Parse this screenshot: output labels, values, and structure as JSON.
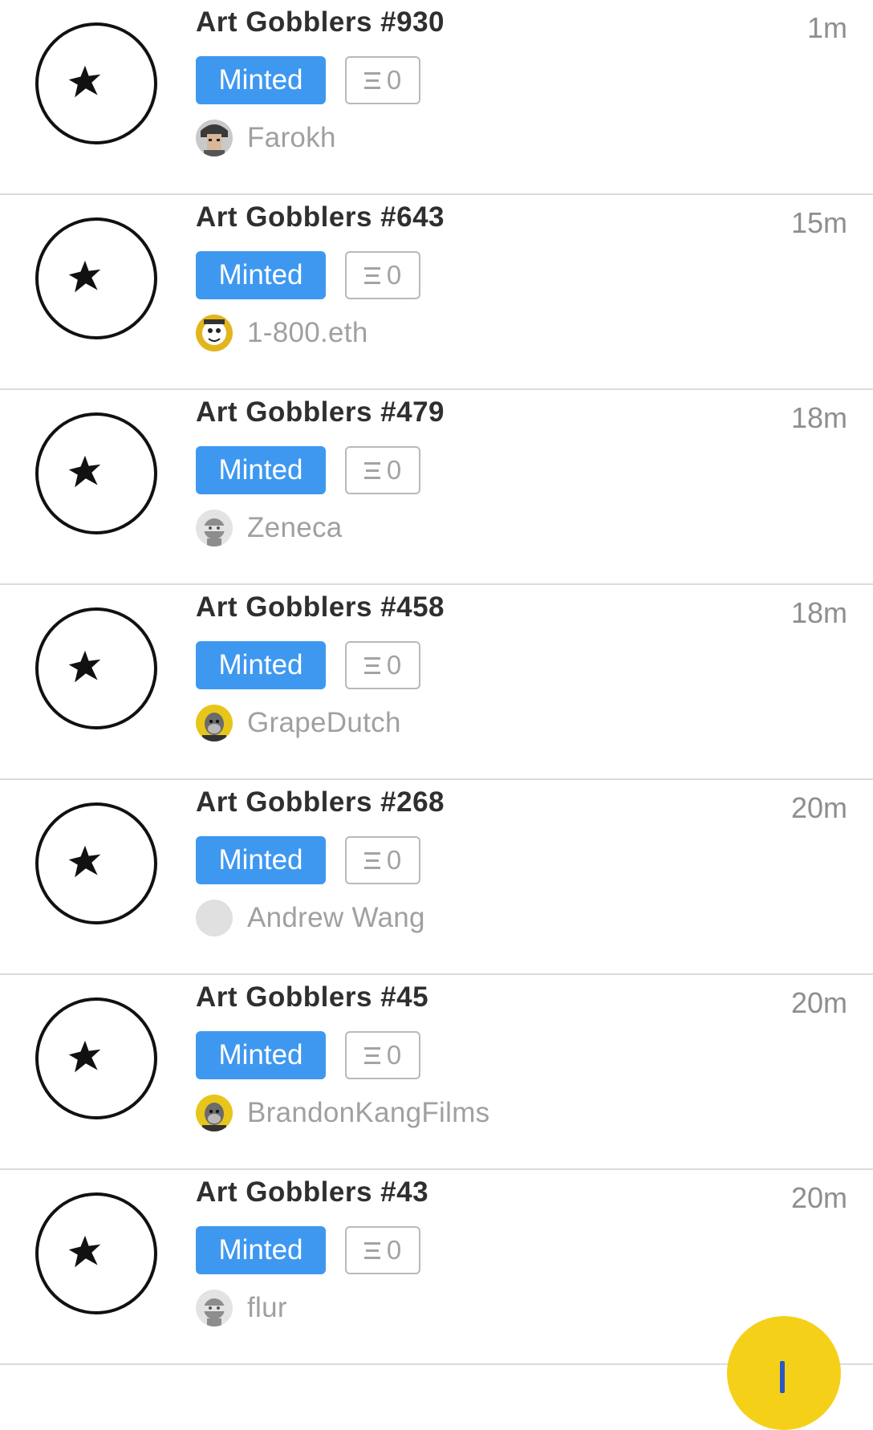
{
  "feed": {
    "items": [
      {
        "title": "Art Gobblers #930",
        "status": "Minted",
        "price": "0",
        "user": "Farokh",
        "time": "1m",
        "avatar_icon": "punk-avatar-icon",
        "avatar_color": "#3a3a3a"
      },
      {
        "title": "Art Gobblers #643",
        "status": "Minted",
        "price": "0",
        "user": "1-800.eth",
        "time": "15m",
        "avatar_icon": "cartoon-avatar-icon",
        "avatar_color": "#e3b51d"
      },
      {
        "title": "Art Gobblers #479",
        "status": "Minted",
        "price": "0",
        "user": "Zeneca",
        "time": "18m",
        "avatar_icon": "default-ninja-avatar-icon",
        "avatar_color": "#e3e3e3"
      },
      {
        "title": "Art Gobblers #458",
        "status": "Minted",
        "price": "0",
        "user": "GrapeDutch",
        "time": "18m",
        "avatar_icon": "ape-avatar-icon",
        "avatar_color": "#e8c51a"
      },
      {
        "title": "Art Gobblers #268",
        "status": "Minted",
        "price": "0",
        "user": "Andrew Wang",
        "time": "20m",
        "avatar_icon": "blank-avatar-icon",
        "avatar_color": "#e0e0e0"
      },
      {
        "title": "Art Gobblers #45",
        "status": "Minted",
        "price": "0",
        "user": "BrandonKangFilms",
        "time": "20m",
        "avatar_icon": "ape-avatar-icon",
        "avatar_color": "#e8c51a"
      },
      {
        "title": "Art Gobblers #43",
        "status": "Minted",
        "price": "0",
        "user": "flur",
        "time": "20m",
        "avatar_icon": "default-ninja-avatar-icon",
        "avatar_color": "#e3e3e3"
      }
    ]
  },
  "colors": {
    "status_badge": "#3f98f0",
    "fab": "#f5d019",
    "fab_icon": "#2a58c6"
  },
  "icons": {
    "thumbnail": "art-gobbler-star-icon",
    "price": "eth-icon",
    "fab": "fab-icon"
  }
}
